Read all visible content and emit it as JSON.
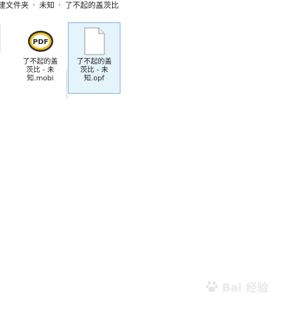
{
  "breadcrumb": {
    "items": [
      "建文件夹",
      "未知",
      "了不起的盖茨比"
    ],
    "separator": "›"
  },
  "files": [
    {
      "name_lines": [
        "了不起的盖",
        "茨比 - 未",
        "知.mobi"
      ],
      "icon": "pdf-reader-icon",
      "selected": false
    },
    {
      "name_lines": [
        "了不起的盖",
        "茨比 - 未",
        "知.opf"
      ],
      "icon": "blank-document-icon",
      "selected": true
    }
  ],
  "watermark": {
    "text": "Bai 经验",
    "icon": "baidu-paw-icon"
  },
  "colors": {
    "selection_bg": "#e5f3fb",
    "selection_border": "#7eb4ea",
    "pdf_icon_yellow": "#f2c21b",
    "pdf_icon_dark": "#2b2b2b"
  }
}
